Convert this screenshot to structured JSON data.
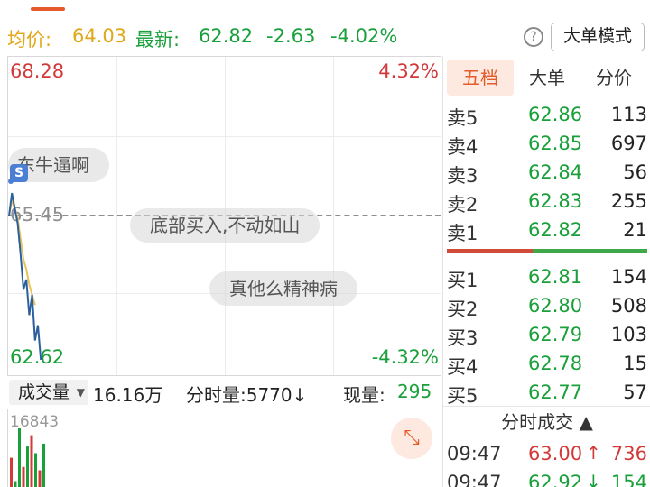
{
  "stats": {
    "avg_label": "均价:",
    "avg_value": "64.03",
    "latest_label": "最新:",
    "latest_value": "62.82",
    "change": "-2.63",
    "change_pct": "-4.02%",
    "help_glyph": "?",
    "mode_button": "大单模式"
  },
  "chart": {
    "top_price": "68.28",
    "top_pct": "4.32%",
    "mid_price": "65.45",
    "bottom_price": "62.62",
    "bottom_pct": "-4.32%",
    "price_range": [
      62.62,
      68.28
    ],
    "prev_close": 65.45,
    "price_line_color": "#2c5f9e",
    "avg_line_color": "#e8c35a",
    "price_points": [
      65.45,
      65.9,
      65.6,
      65.3,
      64.7,
      64.0,
      64.2,
      63.5,
      63.9,
      63.0,
      63.3,
      62.62
    ],
    "avg_points": [
      65.45,
      65.75,
      65.6,
      65.4,
      65.0,
      64.6,
      64.4,
      64.1,
      63.9,
      63.7
    ],
    "danmaku": [
      "东牛逼啊",
      "底部买入,不动如山",
      "真他么精神病"
    ],
    "danmaku_badge": "S"
  },
  "volume": {
    "type_label": "成交量",
    "total": "16.16万",
    "minute_label": "分时量:5770",
    "minute_arrow": "↓",
    "now_label": "现量:",
    "now_value": "295",
    "max_label": "16843",
    "max": 16843,
    "bars": [
      {
        "v": 9800,
        "c": "#d23a3a"
      },
      {
        "v": 4200,
        "c": "#1aa03a"
      },
      {
        "v": 16843,
        "c": "#1aa03a"
      },
      {
        "v": 7600,
        "c": "#d23a3a"
      },
      {
        "v": 12500,
        "c": "#1aa03a"
      },
      {
        "v": 15200,
        "c": "#d23a3a"
      },
      {
        "v": 10900,
        "c": "#1aa03a"
      },
      {
        "v": 6800,
        "c": "#d23a3a"
      },
      {
        "v": 13200,
        "c": "#1aa03a"
      }
    ],
    "expand_glyph": "⤡"
  },
  "panel": {
    "tabs": [
      "五档",
      "大单",
      "分价"
    ],
    "sell": [
      {
        "label": "卖5",
        "price": "62.86",
        "vol": "113"
      },
      {
        "label": "卖4",
        "price": "62.85",
        "vol": "697"
      },
      {
        "label": "卖3",
        "price": "62.84",
        "vol": "56"
      },
      {
        "label": "卖2",
        "price": "62.83",
        "vol": "255"
      },
      {
        "label": "卖1",
        "price": "62.82",
        "vol": "21"
      }
    ],
    "buy": [
      {
        "label": "买1",
        "price": "62.81",
        "vol": "154"
      },
      {
        "label": "买2",
        "price": "62.80",
        "vol": "508"
      },
      {
        "label": "买3",
        "price": "62.79",
        "vol": "103"
      },
      {
        "label": "买4",
        "price": "62.78",
        "vol": "15"
      },
      {
        "label": "买5",
        "price": "62.77",
        "vol": "57"
      }
    ],
    "sell_ratio": 0.43,
    "tick_header": "分时成交 ▲",
    "ticks": [
      {
        "time": "09:47",
        "price": "63.00",
        "dir": "↑",
        "vol": "736",
        "price_color": "#d23a3a",
        "vol_color": "#d23a3a"
      },
      {
        "time": "09:47",
        "price": "62.92",
        "dir": "↓",
        "vol": "154",
        "price_color": "#1aa03a",
        "vol_color": "#1aa03a"
      }
    ]
  }
}
